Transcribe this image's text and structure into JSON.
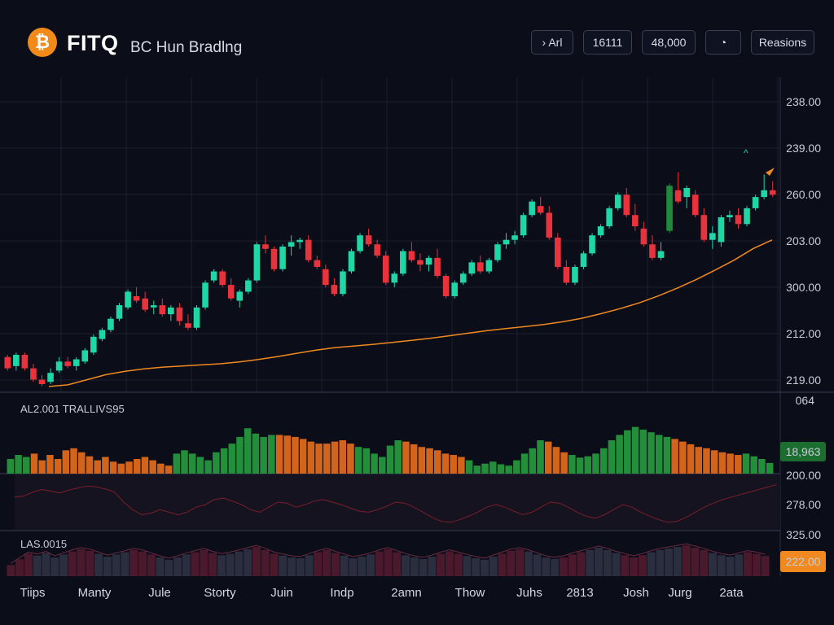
{
  "header": {
    "logo_glyph": "₿",
    "brand": "FITQ",
    "subtitle": "BC Hun Bradlng",
    "buttons": [
      {
        "label": "› Arl"
      },
      {
        "label": "16111"
      },
      {
        "label": "48,000"
      },
      {
        "label": "◔",
        "icon": "globe-icon"
      },
      {
        "label": "Reasions"
      }
    ]
  },
  "colors": {
    "up": "#1fd6a6",
    "up_dark": "#1f8a3c",
    "down": "#e8333d",
    "ma": "#f08a20",
    "vol_green": "#238f3a",
    "vol_orange": "#d2641c",
    "badge_green": "#1b6e2f",
    "badge_orange": "#f08a20"
  },
  "chart_data": [
    {
      "type": "candlestick",
      "title": "",
      "y_tick_labels": [
        "238.00",
        "239.00",
        "260.00",
        "203.00",
        "300.00",
        "212.00",
        "219.00"
      ],
      "ylim": [
        0,
        100
      ],
      "grid": true,
      "x_tick_labels": [
        "Tiips",
        "Manty",
        "Jule",
        "Storty",
        "Juin",
        "Indp",
        "2amn",
        "Thow",
        "Juhs",
        "2813",
        "Josh",
        "Jurg",
        "2ata"
      ],
      "candles": [
        {
          "o": 12,
          "h": 13,
          "l": 6,
          "c": 7
        },
        {
          "o": 8,
          "h": 14,
          "l": 6,
          "c": 13
        },
        {
          "o": 13,
          "h": 14,
          "l": 6,
          "c": 7
        },
        {
          "o": 7,
          "h": 9,
          "l": 1,
          "c": 2
        },
        {
          "o": 2,
          "h": 4,
          "l": -1,
          "c": 0
        },
        {
          "o": 1,
          "h": 7,
          "l": 0,
          "c": 5
        },
        {
          "o": 6,
          "h": 12,
          "l": 5,
          "c": 10
        },
        {
          "o": 10,
          "h": 12,
          "l": 7,
          "c": 8
        },
        {
          "o": 8,
          "h": 12,
          "l": 6,
          "c": 11
        },
        {
          "o": 10,
          "h": 16,
          "l": 9,
          "c": 15
        },
        {
          "o": 14,
          "h": 22,
          "l": 13,
          "c": 21
        },
        {
          "o": 20,
          "h": 25,
          "l": 19,
          "c": 24
        },
        {
          "o": 24,
          "h": 30,
          "l": 23,
          "c": 29
        },
        {
          "o": 29,
          "h": 36,
          "l": 28,
          "c": 35
        },
        {
          "o": 34,
          "h": 42,
          "l": 33,
          "c": 41
        },
        {
          "o": 39,
          "h": 43,
          "l": 36,
          "c": 37
        },
        {
          "o": 38,
          "h": 41,
          "l": 32,
          "c": 33
        },
        {
          "o": 34,
          "h": 37,
          "l": 31,
          "c": 35
        },
        {
          "o": 35,
          "h": 38,
          "l": 30,
          "c": 31
        },
        {
          "o": 31,
          "h": 35,
          "l": 28,
          "c": 34
        },
        {
          "o": 34,
          "h": 36,
          "l": 26,
          "c": 28
        },
        {
          "o": 27,
          "h": 31,
          "l": 24,
          "c": 25
        },
        {
          "o": 25,
          "h": 35,
          "l": 24,
          "c": 34
        },
        {
          "o": 34,
          "h": 46,
          "l": 33,
          "c": 45
        },
        {
          "o": 46,
          "h": 51,
          "l": 45,
          "c": 50
        },
        {
          "o": 50,
          "h": 51,
          "l": 43,
          "c": 44
        },
        {
          "o": 44,
          "h": 47,
          "l": 37,
          "c": 38
        },
        {
          "o": 37,
          "h": 42,
          "l": 34,
          "c": 41
        },
        {
          "o": 41,
          "h": 47,
          "l": 40,
          "c": 46
        },
        {
          "o": 46,
          "h": 63,
          "l": 45,
          "c": 62
        },
        {
          "o": 62,
          "h": 66,
          "l": 58,
          "c": 60
        },
        {
          "o": 60,
          "h": 61,
          "l": 50,
          "c": 51
        },
        {
          "o": 51,
          "h": 62,
          "l": 50,
          "c": 61
        },
        {
          "o": 61,
          "h": 66,
          "l": 57,
          "c": 63
        },
        {
          "o": 63,
          "h": 65,
          "l": 60,
          "c": 64
        },
        {
          "o": 64,
          "h": 66,
          "l": 54,
          "c": 55
        },
        {
          "o": 55,
          "h": 57,
          "l": 51,
          "c": 52
        },
        {
          "o": 51,
          "h": 53,
          "l": 43,
          "c": 44
        },
        {
          "o": 44,
          "h": 47,
          "l": 39,
          "c": 40
        },
        {
          "o": 40,
          "h": 51,
          "l": 39,
          "c": 50
        },
        {
          "o": 50,
          "h": 60,
          "l": 49,
          "c": 59
        },
        {
          "o": 59,
          "h": 67,
          "l": 58,
          "c": 66
        },
        {
          "o": 66,
          "h": 69,
          "l": 61,
          "c": 62
        },
        {
          "o": 62,
          "h": 64,
          "l": 56,
          "c": 57
        },
        {
          "o": 57,
          "h": 59,
          "l": 44,
          "c": 45
        },
        {
          "o": 45,
          "h": 50,
          "l": 43,
          "c": 49
        },
        {
          "o": 49,
          "h": 60,
          "l": 48,
          "c": 59
        },
        {
          "o": 59,
          "h": 63,
          "l": 54,
          "c": 55
        },
        {
          "o": 55,
          "h": 58,
          "l": 50,
          "c": 53
        },
        {
          "o": 53,
          "h": 57,
          "l": 50,
          "c": 56
        },
        {
          "o": 56,
          "h": 60,
          "l": 47,
          "c": 48
        },
        {
          "o": 48,
          "h": 49,
          "l": 38,
          "c": 39
        },
        {
          "o": 39,
          "h": 46,
          "l": 38,
          "c": 45
        },
        {
          "o": 45,
          "h": 50,
          "l": 44,
          "c": 49
        },
        {
          "o": 49,
          "h": 55,
          "l": 48,
          "c": 54
        },
        {
          "o": 54,
          "h": 57,
          "l": 49,
          "c": 50
        },
        {
          "o": 50,
          "h": 56,
          "l": 49,
          "c": 55
        },
        {
          "o": 55,
          "h": 63,
          "l": 54,
          "c": 62
        },
        {
          "o": 62,
          "h": 67,
          "l": 60,
          "c": 64
        },
        {
          "o": 64,
          "h": 68,
          "l": 62,
          "c": 66
        },
        {
          "o": 66,
          "h": 76,
          "l": 65,
          "c": 75
        },
        {
          "o": 75,
          "h": 82,
          "l": 74,
          "c": 81
        },
        {
          "o": 79,
          "h": 83,
          "l": 75,
          "c": 76
        },
        {
          "o": 76,
          "h": 79,
          "l": 64,
          "c": 65
        },
        {
          "o": 65,
          "h": 67,
          "l": 51,
          "c": 52
        },
        {
          "o": 52,
          "h": 55,
          "l": 44,
          "c": 45
        },
        {
          "o": 45,
          "h": 53,
          "l": 44,
          "c": 52
        },
        {
          "o": 52,
          "h": 59,
          "l": 51,
          "c": 58
        },
        {
          "o": 58,
          "h": 67,
          "l": 57,
          "c": 66
        },
        {
          "o": 66,
          "h": 71,
          "l": 65,
          "c": 70
        },
        {
          "o": 70,
          "h": 79,
          "l": 69,
          "c": 78
        },
        {
          "o": 78,
          "h": 85,
          "l": 77,
          "c": 84
        },
        {
          "o": 84,
          "h": 87,
          "l": 74,
          "c": 75
        },
        {
          "o": 75,
          "h": 80,
          "l": 68,
          "c": 70
        },
        {
          "o": 69,
          "h": 72,
          "l": 61,
          "c": 62
        },
        {
          "o": 62,
          "h": 66,
          "l": 55,
          "c": 56
        },
        {
          "o": 56,
          "h": 63,
          "l": 55,
          "c": 59
        },
        {
          "o": 68,
          "h": 89,
          "l": 67,
          "c": 88
        },
        {
          "o": 86,
          "h": 94,
          "l": 80,
          "c": 81
        },
        {
          "o": 83,
          "h": 88,
          "l": 78,
          "c": 87
        },
        {
          "o": 84,
          "h": 86,
          "l": 74,
          "c": 75
        },
        {
          "o": 75,
          "h": 78,
          "l": 63,
          "c": 64
        },
        {
          "o": 64,
          "h": 70,
          "l": 60,
          "c": 67
        },
        {
          "o": 63,
          "h": 75,
          "l": 61,
          "c": 74
        },
        {
          "o": 74,
          "h": 77,
          "l": 72,
          "c": 75
        },
        {
          "o": 75,
          "h": 78,
          "l": 69,
          "c": 71
        },
        {
          "o": 71,
          "h": 79,
          "l": 70,
          "c": 78
        },
        {
          "o": 78,
          "h": 84,
          "l": 77,
          "c": 83
        },
        {
          "o": 83,
          "h": 93,
          "l": 82,
          "c": 86
        },
        {
          "o": 86,
          "h": 90,
          "l": 83,
          "c": 84
        }
      ],
      "moving_average": [
        1,
        2,
        5,
        8,
        10,
        11.5,
        12.5,
        13.2,
        13.8,
        14.5,
        15.6,
        17,
        18.7,
        20.7,
        22.5,
        24,
        25,
        26,
        27.1,
        28.3,
        29.6,
        31,
        32.6,
        34.1,
        35.4,
        36.5,
        37.8,
        39.4,
        41.5,
        44.2,
        47.2,
        50.6,
        54.7,
        59.3,
        64.4,
        70.1,
        76,
        82.8,
        88
      ],
      "ma_points": 39
    },
    {
      "type": "bar",
      "title": "AL2.001 TRALLIVS95",
      "y_tick_labels": [
        "064",
        "200.00"
      ],
      "badge": "18,963",
      "ylim": [
        0,
        100
      ],
      "values": [
        22,
        28,
        25,
        30,
        20,
        28,
        22,
        35,
        38,
        32,
        26,
        20,
        25,
        18,
        15,
        18,
        22,
        25,
        20,
        15,
        12,
        30,
        35,
        30,
        25,
        20,
        32,
        38,
        45,
        55,
        68,
        60,
        55,
        58,
        58,
        57,
        55,
        52,
        48,
        45,
        45,
        48,
        50,
        45,
        40,
        38,
        30,
        25,
        42,
        50,
        48,
        44,
        40,
        38,
        35,
        30,
        28,
        25,
        20,
        12,
        15,
        18,
        14,
        12,
        20,
        30,
        38,
        50,
        48,
        40,
        32,
        28,
        24,
        26,
        30,
        38,
        50,
        58,
        65,
        70,
        66,
        62,
        58,
        55,
        52,
        48,
        44,
        40,
        38,
        35,
        32,
        30,
        28,
        30,
        26,
        22,
        16
      ],
      "colors_key": [
        "g",
        "g",
        "g",
        "o",
        "o",
        "o",
        "o",
        "o",
        "o",
        "o",
        "o",
        "o",
        "o",
        "o",
        "o",
        "o",
        "o",
        "o",
        "o",
        "o",
        "o",
        "g",
        "g",
        "g",
        "g",
        "g",
        "g",
        "g",
        "g",
        "g",
        "g",
        "g",
        "g",
        "g",
        "o",
        "o",
        "o",
        "o",
        "o",
        "o",
        "o",
        "o",
        "o",
        "o",
        "g",
        "g",
        "g",
        "g",
        "g",
        "g",
        "o",
        "o",
        "o",
        "o",
        "o",
        "o",
        "o",
        "o",
        "g",
        "g",
        "g",
        "g",
        "g",
        "g",
        "g",
        "g",
        "g",
        "g",
        "o",
        "o",
        "o",
        "g",
        "g",
        "g",
        "g",
        "g",
        "g",
        "g",
        "g",
        "g",
        "g",
        "g",
        "g",
        "g",
        "o",
        "o",
        "o",
        "o",
        "o",
        "o",
        "o",
        "o",
        "o",
        "g",
        "g",
        "g",
        "g"
      ]
    },
    {
      "type": "line",
      "title": "",
      "y_tick_labels": [
        "278.00",
        "325.00"
      ],
      "values": [
        60,
        62,
        70,
        75,
        72,
        68,
        74,
        78,
        82,
        80,
        76,
        70,
        50,
        35,
        25,
        28,
        35,
        30,
        25,
        30,
        40,
        45,
        55,
        58,
        52,
        45,
        35,
        30,
        40,
        50,
        48,
        40,
        45,
        52,
        55,
        50,
        45,
        38,
        32,
        30,
        35,
        42,
        50,
        48,
        40,
        30,
        20,
        12,
        10,
        15,
        22,
        30,
        40,
        45,
        40,
        32,
        25,
        30,
        40,
        50,
        48,
        40,
        30,
        22,
        18,
        25,
        35,
        45,
        40,
        30,
        22,
        15,
        10,
        12,
        20,
        30,
        40,
        48,
        55,
        60,
        65,
        70,
        75,
        80,
        85
      ]
    },
    {
      "type": "bar",
      "title": "LAS.0015",
      "badge": "222.00",
      "ylim": [
        0,
        100
      ],
      "values": [
        30,
        45,
        60,
        55,
        62,
        50,
        58,
        66,
        72,
        68,
        60,
        52,
        58,
        64,
        70,
        66,
        58,
        50,
        44,
        50,
        58,
        64,
        70,
        62,
        56,
        60,
        66,
        72,
        78,
        70,
        60,
        55,
        50,
        48,
        56,
        64,
        70,
        62,
        55,
        48,
        52,
        58,
        66,
        72,
        64,
        56,
        50,
        46,
        52,
        60,
        66,
        60,
        54,
        48,
        44,
        52,
        60,
        68,
        72,
        66,
        58,
        50,
        46,
        50,
        58,
        64,
        70,
        76,
        70,
        62,
        56,
        50,
        56,
        64,
        70,
        74,
        78,
        82,
        76,
        70,
        62,
        56,
        52,
        58,
        64,
        60,
        54
      ]
    }
  ]
}
